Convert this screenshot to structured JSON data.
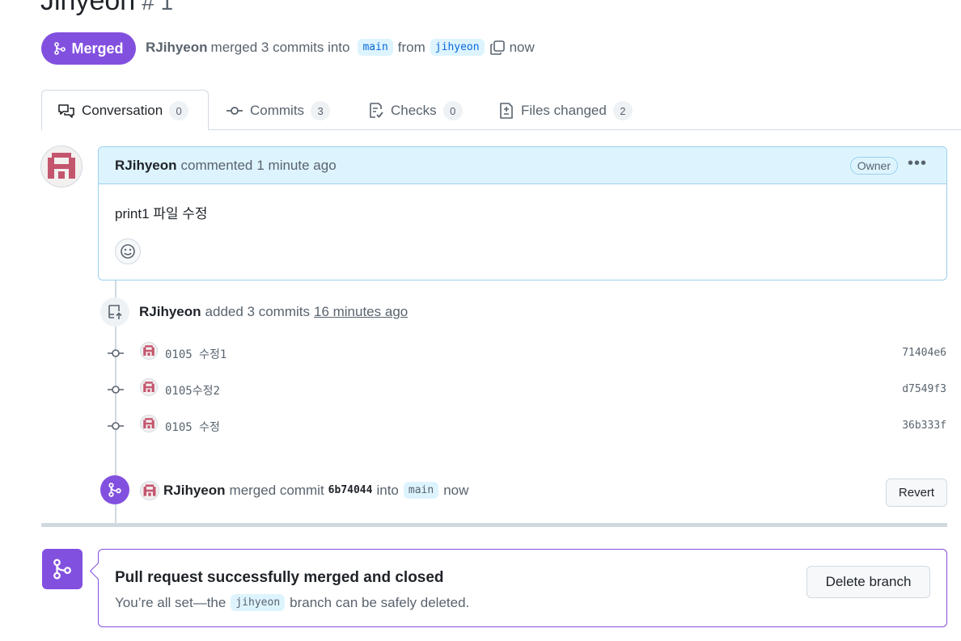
{
  "pr": {
    "title": "Jinyeon",
    "number": "# 1",
    "state": "Merged",
    "author": "RJihyeon",
    "merged_text": "merged 3 commits into",
    "base_branch": "main",
    "from_text": "from",
    "head_branch": "jihyeon",
    "time": "now"
  },
  "tabs": [
    {
      "label": "Conversation",
      "count": "0",
      "icon": "comment-discussion-icon"
    },
    {
      "label": "Commits",
      "count": "3",
      "icon": "git-commit-icon"
    },
    {
      "label": "Checks",
      "count": "0",
      "icon": "checklist-icon"
    },
    {
      "label": "Files changed",
      "count": "2",
      "icon": "file-diff-icon"
    }
  ],
  "comment": {
    "author": "RJihyeon",
    "action": "commented",
    "time": "1 minute ago",
    "role": "Owner",
    "body": "print1 파일 수정"
  },
  "commits_event": {
    "author": "RJihyeon",
    "text": "added 3 commits",
    "time": "16 minutes ago"
  },
  "commits": [
    {
      "message": "0105 수정1",
      "sha": "71404e6"
    },
    {
      "message": "0105수정2",
      "sha": "d7549f3"
    },
    {
      "message": "0105 수정",
      "sha": "36b333f"
    }
  ],
  "merge_event": {
    "author": "RJihyeon",
    "text": "merged commit",
    "sha": "6b74044",
    "into": "into",
    "branch": "main",
    "time": "now",
    "revert_label": "Revert"
  },
  "merge_box": {
    "title": "Pull request successfully merged and closed",
    "sub_before": "You’re all set—the",
    "branch": "jihyeon",
    "sub_after": "branch can be safely deleted.",
    "delete_label": "Delete branch"
  },
  "colors": {
    "merged_purple": "#8250df",
    "comment_header_bg": "#ddf4ff",
    "avatar_pink": "#c4556e"
  }
}
